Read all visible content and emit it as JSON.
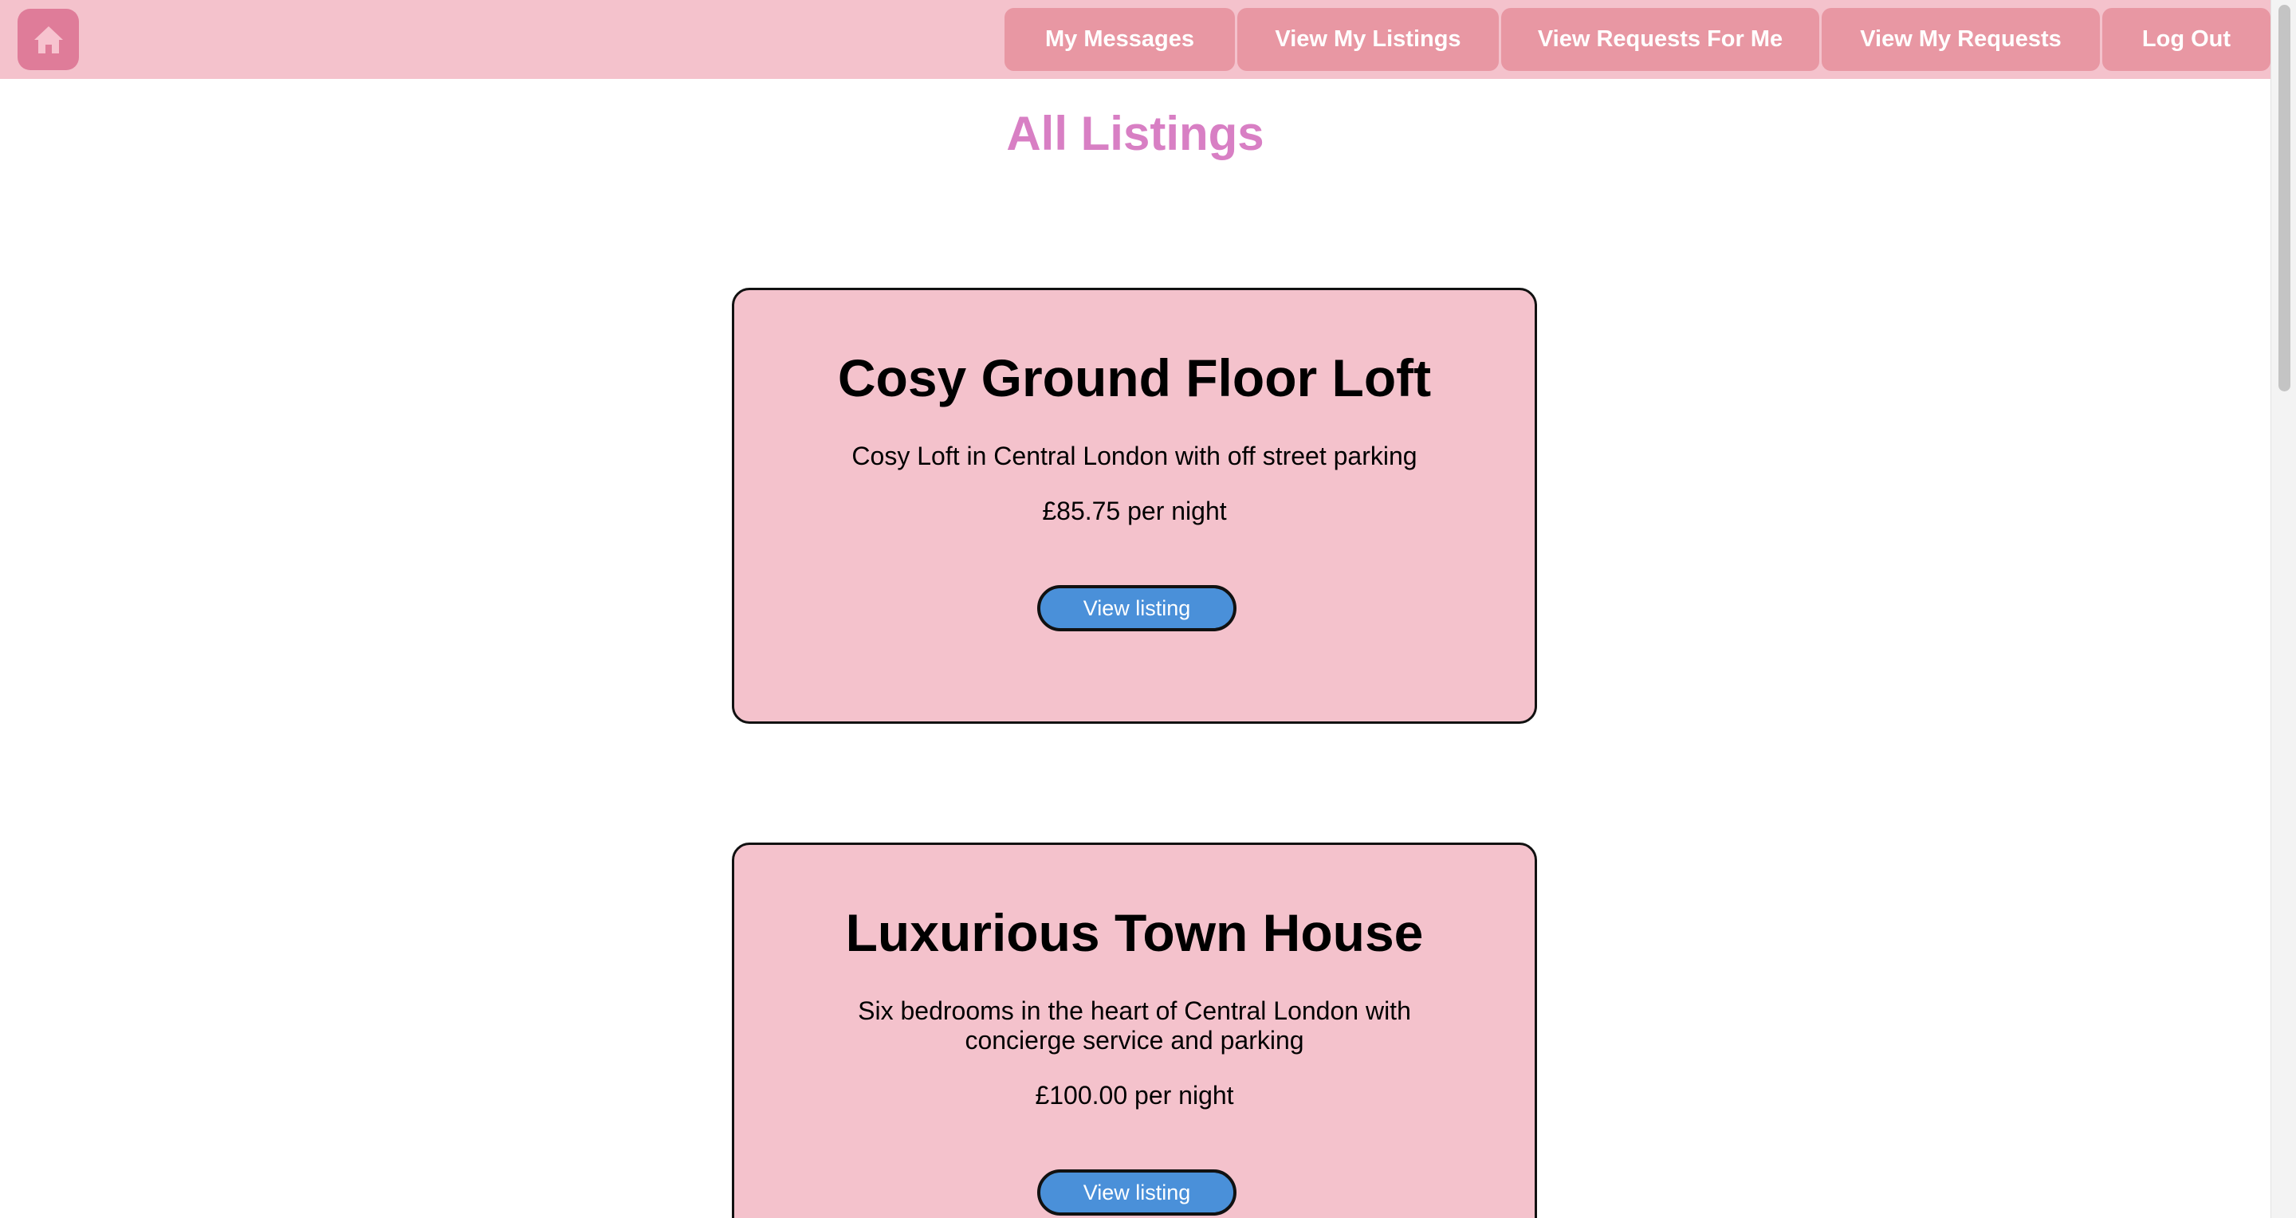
{
  "navbar": {
    "home_icon": "home-icon",
    "items": [
      {
        "label": "My Messages"
      },
      {
        "label": "View My Listings"
      },
      {
        "label": "View Requests For Me"
      },
      {
        "label": "View My Requests"
      },
      {
        "label": "Log Out"
      }
    ]
  },
  "page": {
    "title": "All Listings"
  },
  "listings": [
    {
      "title": "Cosy Ground Floor Loft",
      "description": "Cosy Loft in Central London with off street parking",
      "price": "£85.75 per night",
      "button_label": "View listing"
    },
    {
      "title": "Luxurious Town House",
      "description_line1": "Six bedrooms in the heart of Central London with",
      "description_line2": "concierge service and parking",
      "price": "£100.00 per night",
      "button_label": "View listing"
    }
  ],
  "colors": {
    "navbar_bg": "#f4c2cc",
    "nav_button_bg": "#e897a3",
    "home_button_bg": "#df7c99",
    "title_color": "#d87fc4",
    "card_bg": "#f4c2cc",
    "view_button_bg": "#4a90d9"
  }
}
